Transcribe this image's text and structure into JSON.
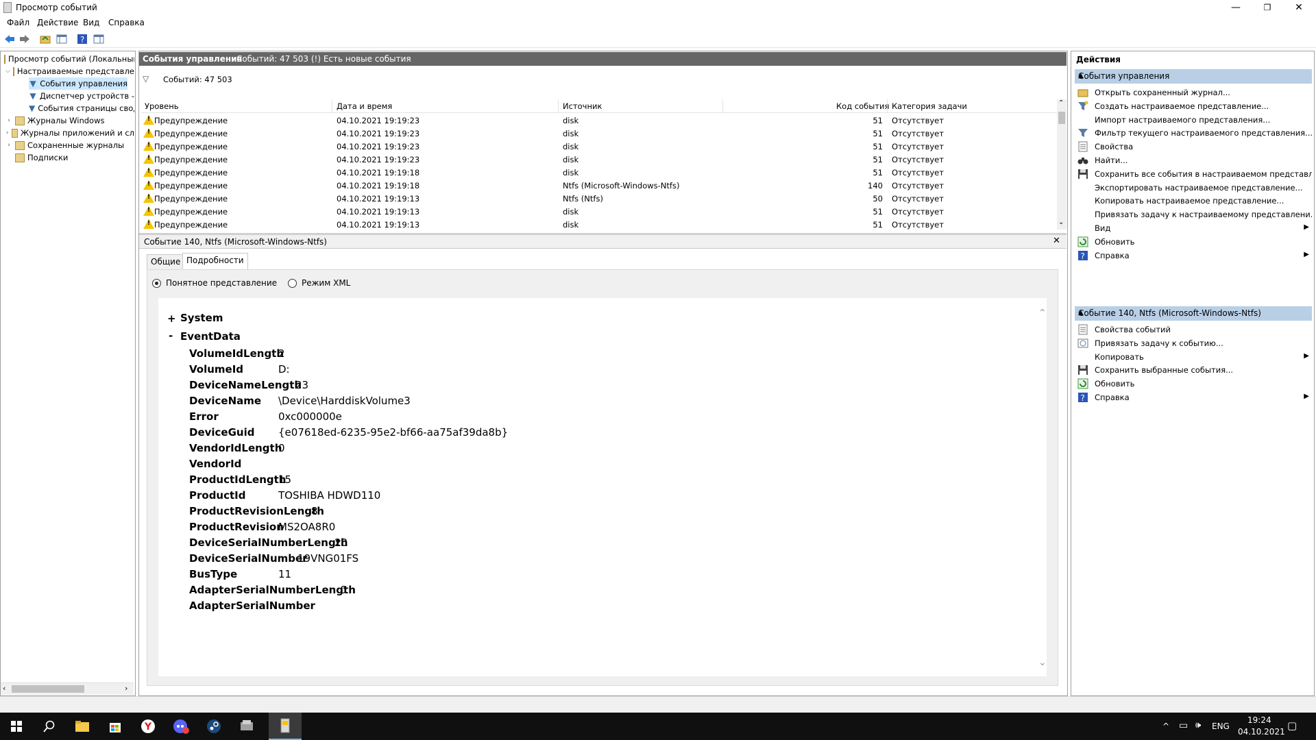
{
  "window": {
    "title": "Просмотр событий",
    "controls": {
      "minimize": "—",
      "restore": "❐",
      "close": "✕"
    }
  },
  "menu": [
    "Файл",
    "Действие",
    "Вид",
    "Справка"
  ],
  "tree": {
    "root": "Просмотр событий (Локальный)",
    "custom_views": "Настраиваемые представления",
    "admin_events": "События управления",
    "device_manager": "Диспетчер устройств -",
    "page_events": "События страницы свод",
    "windows_logs": "Журналы Windows",
    "app_logs": "Журналы приложений и сл",
    "saved_logs": "Сохраненные журналы",
    "subscriptions": "Подписки"
  },
  "center": {
    "header_title": "События управления",
    "header_info": "Событий: 47 503 (!) Есть новые события",
    "filter_text": "Событий: 47 503",
    "columns": [
      "Уровень",
      "Дата и время",
      "Источник",
      "Код события",
      "Категория задачи"
    ],
    "rows": [
      {
        "level": "Предупреждение",
        "date": "04.10.2021 19:19:23",
        "source": "disk",
        "code": "51",
        "category": "Отсутствует"
      },
      {
        "level": "Предупреждение",
        "date": "04.10.2021 19:19:23",
        "source": "disk",
        "code": "51",
        "category": "Отсутствует"
      },
      {
        "level": "Предупреждение",
        "date": "04.10.2021 19:19:23",
        "source": "disk",
        "code": "51",
        "category": "Отсутствует"
      },
      {
        "level": "Предупреждение",
        "date": "04.10.2021 19:19:23",
        "source": "disk",
        "code": "51",
        "category": "Отсутствует"
      },
      {
        "level": "Предупреждение",
        "date": "04.10.2021 19:19:18",
        "source": "disk",
        "code": "51",
        "category": "Отсутствует"
      },
      {
        "level": "Предупреждение",
        "date": "04.10.2021 19:19:18",
        "source": "Ntfs (Microsoft-Windows-Ntfs)",
        "code": "140",
        "category": "Отсутствует"
      },
      {
        "level": "Предупреждение",
        "date": "04.10.2021 19:19:13",
        "source": "Ntfs (Ntfs)",
        "code": "50",
        "category": "Отсутствует"
      },
      {
        "level": "Предупреждение",
        "date": "04.10.2021 19:19:13",
        "source": "disk",
        "code": "51",
        "category": "Отсутствует"
      },
      {
        "level": "Предупреждение",
        "date": "04.10.2021 19:19:13",
        "source": "disk",
        "code": "51",
        "category": "Отсутствует"
      }
    ]
  },
  "detail": {
    "title": "Событие 140, Ntfs (Microsoft-Windows-Ntfs)",
    "close": "✕",
    "tabs": [
      "Общие",
      "Подробности"
    ],
    "radio_friendly": "Понятное представление",
    "radio_xml": "Режим XML",
    "system_toggle": "+",
    "system_label": "System",
    "eventdata_toggle": "-",
    "eventdata_label": "EventData",
    "fields": [
      {
        "key": "VolumeIdLength",
        "value": "2"
      },
      {
        "key": "VolumeId",
        "value": "D:"
      },
      {
        "key": "DeviceNameLength",
        "value": "23"
      },
      {
        "key": "DeviceName",
        "value": "\\Device\\HarddiskVolume3"
      },
      {
        "key": "Error",
        "value": "0xc000000e"
      },
      {
        "key": "DeviceGuid",
        "value": "{e07618ed-6235-95e2-bf66-aa75af39da8b}"
      },
      {
        "key": "VendorIdLength",
        "value": "0"
      },
      {
        "key": "VendorId",
        "value": ""
      },
      {
        "key": "ProductIdLength",
        "value": "15"
      },
      {
        "key": "ProductId",
        "value": "TOSHIBA HDWD110"
      },
      {
        "key": "ProductRevisionLength",
        "value": "8"
      },
      {
        "key": "ProductRevision",
        "value": "MS2OA8R0"
      },
      {
        "key": "DeviceSerialNumberLength",
        "value": "20"
      },
      {
        "key": "DeviceSerialNumber",
        "value": "19VNG01FS"
      },
      {
        "key": "BusType",
        "value": "11"
      },
      {
        "key": "AdapterSerialNumberLength",
        "value": "0"
      },
      {
        "key": "AdapterSerialNumber",
        "value": ""
      }
    ]
  },
  "actions": {
    "title": "Действия",
    "section1": "События управления",
    "items1": [
      {
        "label": "Открыть сохраненный журнал...",
        "icon": "folder-open-icon"
      },
      {
        "label": "Создать настраиваемое представление...",
        "icon": "filter-create-icon"
      },
      {
        "label": "Импорт настраиваемого представления...",
        "icon": ""
      },
      {
        "label": "Фильтр текущего настраиваемого представления...",
        "icon": "filter-icon"
      },
      {
        "label": "Свойства",
        "icon": "properties-icon"
      },
      {
        "label": "Найти...",
        "icon": "binoculars-icon"
      },
      {
        "label": "Сохранить все события в настраиваемом представл...",
        "icon": "save-icon"
      },
      {
        "label": "Экспортировать настраиваемое представление...",
        "icon": ""
      },
      {
        "label": "Копировать настраиваемое представление...",
        "icon": ""
      },
      {
        "label": "Привязать задачу к настраиваемому представлени...",
        "icon": ""
      },
      {
        "label": "Вид",
        "icon": "",
        "submenu": true
      },
      {
        "label": "Обновить",
        "icon": "refresh-icon"
      },
      {
        "label": "Справка",
        "icon": "help-icon",
        "submenu": true
      }
    ],
    "section2": "Событие 140, Ntfs (Microsoft-Windows-Ntfs)",
    "items2": [
      {
        "label": "Свойства событий",
        "icon": "properties-icon"
      },
      {
        "label": "Привязать задачу к событию...",
        "icon": "task-icon"
      },
      {
        "label": "Копировать",
        "icon": "copy-icon",
        "submenu": true
      },
      {
        "label": "Сохранить выбранные события...",
        "icon": "save-icon"
      },
      {
        "label": "Обновить",
        "icon": "refresh-icon"
      },
      {
        "label": "Справка",
        "icon": "help-icon",
        "submenu": true
      }
    ]
  },
  "taskbar": {
    "lang": "ENG",
    "time": "19:24",
    "date": "04.10.2021"
  }
}
